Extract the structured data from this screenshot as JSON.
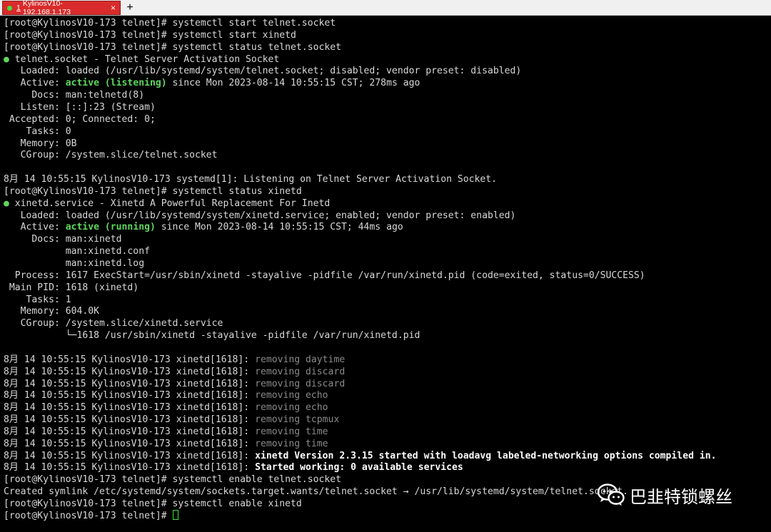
{
  "tabs": [
    {
      "number": "1",
      "label": "KylinosV10-192.168.1.173",
      "close": "×",
      "status_color": "#3be23b",
      "color": "#d92b2b"
    }
  ],
  "new_tab": "+",
  "terminal": {
    "lines": [
      [
        {
          "t": "[root@KylinosV10-173 telnet]# systemctl start telnet.socket"
        }
      ],
      [
        {
          "t": "[root@KylinosV10-173 telnet]# systemctl start xinetd"
        }
      ],
      [
        {
          "t": "[root@KylinosV10-173 telnet]# systemctl status telnet.socket"
        }
      ],
      [
        {
          "t": "●",
          "c": "g"
        },
        {
          "t": " telnet.socket - Telnet Server Activation Socket"
        }
      ],
      [
        {
          "t": "   Loaded: loaded (/usr/lib/systemd/system/telnet.socket; disabled; vendor preset: disabled)"
        }
      ],
      [
        {
          "t": "   Active: "
        },
        {
          "t": "active (listening)",
          "c": "g"
        },
        {
          "t": " since Mon 2023-08-14 10:55:15 CST; 278ms ago"
        }
      ],
      [
        {
          "t": "     Docs: man:telnetd(8)"
        }
      ],
      [
        {
          "t": "   Listen: [::]:23 (Stream)"
        }
      ],
      [
        {
          "t": " Accepted: 0; Connected: 0;"
        }
      ],
      [
        {
          "t": "    Tasks: 0"
        }
      ],
      [
        {
          "t": "   Memory: 0B"
        }
      ],
      [
        {
          "t": "   CGroup: /system.slice/telnet.socket"
        }
      ],
      [
        {
          "t": ""
        }
      ],
      [
        {
          "t": "8月 14 10:55:15 KylinosV10-173 systemd[1]: Listening on Telnet Server Activation Socket."
        }
      ],
      [
        {
          "t": "[root@KylinosV10-173 telnet]# systemctl status xinetd"
        }
      ],
      [
        {
          "t": "●",
          "c": "g"
        },
        {
          "t": " xinetd.service - Xinetd A Powerful Replacement For Inetd"
        }
      ],
      [
        {
          "t": "   Loaded: loaded (/usr/lib/systemd/system/xinetd.service; enabled; vendor preset: enabled)"
        }
      ],
      [
        {
          "t": "   Active: "
        },
        {
          "t": "active (running)",
          "c": "g"
        },
        {
          "t": " since Mon 2023-08-14 10:55:15 CST; 44ms ago"
        }
      ],
      [
        {
          "t": "     Docs: man:xinetd"
        }
      ],
      [
        {
          "t": "           man:xinetd.conf"
        }
      ],
      [
        {
          "t": "           man:xinetd.log"
        }
      ],
      [
        {
          "t": "  Process: 1617 ExecStart=/usr/sbin/xinetd -stayalive -pidfile /var/run/xinetd.pid (code=exited, status=0/SUCCESS)"
        }
      ],
      [
        {
          "t": " Main PID: 1618 (xinetd)"
        }
      ],
      [
        {
          "t": "    Tasks: 1"
        }
      ],
      [
        {
          "t": "   Memory: 604.0K"
        }
      ],
      [
        {
          "t": "   CGroup: /system.slice/xinetd.service"
        }
      ],
      [
        {
          "t": "           └─1618 /usr/sbin/xinetd -stayalive -pidfile /var/run/xinetd.pid"
        }
      ],
      [
        {
          "t": ""
        }
      ],
      [
        {
          "t": "8月 14 10:55:15 KylinosV10-173 xinetd[1618]: "
        },
        {
          "t": "removing daytime",
          "c": "gray"
        }
      ],
      [
        {
          "t": "8月 14 10:55:15 KylinosV10-173 xinetd[1618]: "
        },
        {
          "t": "removing discard",
          "c": "gray"
        }
      ],
      [
        {
          "t": "8月 14 10:55:15 KylinosV10-173 xinetd[1618]: "
        },
        {
          "t": "removing discard",
          "c": "gray"
        }
      ],
      [
        {
          "t": "8月 14 10:55:15 KylinosV10-173 xinetd[1618]: "
        },
        {
          "t": "removing echo",
          "c": "gray"
        }
      ],
      [
        {
          "t": "8月 14 10:55:15 KylinosV10-173 xinetd[1618]: "
        },
        {
          "t": "removing echo",
          "c": "gray"
        }
      ],
      [
        {
          "t": "8月 14 10:55:15 KylinosV10-173 xinetd[1618]: "
        },
        {
          "t": "removing tcpmux",
          "c": "gray"
        }
      ],
      [
        {
          "t": "8月 14 10:55:15 KylinosV10-173 xinetd[1618]: "
        },
        {
          "t": "removing time",
          "c": "gray"
        }
      ],
      [
        {
          "t": "8月 14 10:55:15 KylinosV10-173 xinetd[1618]: "
        },
        {
          "t": "removing time",
          "c": "gray"
        }
      ],
      [
        {
          "t": "8月 14 10:55:15 KylinosV10-173 xinetd[1618]: "
        },
        {
          "t": "xinetd Version 2.3.15 started with loadavg labeled-networking options compiled in.",
          "c": "b"
        }
      ],
      [
        {
          "t": "8月 14 10:55:15 KylinosV10-173 xinetd[1618]: "
        },
        {
          "t": "Started working: 0 available services",
          "c": "b"
        }
      ],
      [
        {
          "t": "[root@KylinosV10-173 telnet]# systemctl enable telnet.socket"
        }
      ],
      [
        {
          "t": "Created symlink /etc/systemd/system/sockets.target.wants/telnet.socket → /usr/lib/systemd/system/telnet.socket."
        }
      ],
      [
        {
          "t": "[root@KylinosV10-173 telnet]# systemctl enable xinetd"
        }
      ],
      [
        {
          "t": "[root@KylinosV10-173 telnet]# "
        }
      ]
    ]
  },
  "watermark": {
    "icon": "wechat-icon",
    "text": "巴韭特锁螺丝"
  },
  "colors": {
    "background": "#000000",
    "text": "#d8d8d8",
    "active_green": "#5fd75f",
    "muted": "#8a8a8a",
    "cursor": "#3be23b"
  }
}
